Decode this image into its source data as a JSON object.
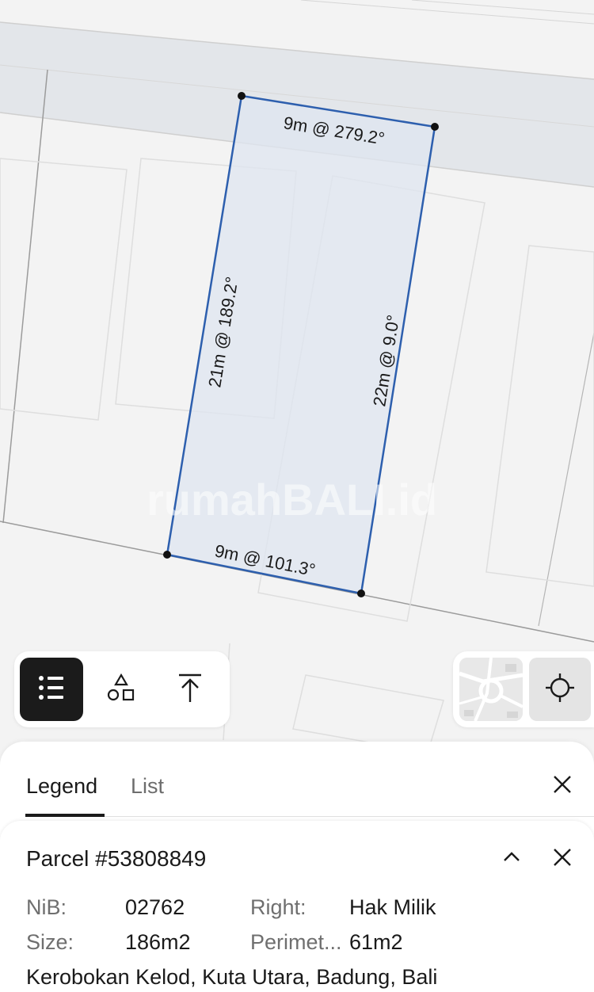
{
  "map": {
    "edges": {
      "top": "9m @ 279.2°",
      "left": "21m @ 189.2°",
      "right": "22m @ 9.0°",
      "bottom": "9m @ 101.3°"
    },
    "watermark": "rumahBALI.id",
    "parcel_stroke_color": "#2d5fae",
    "parcel_fill_color": "#dfe5f0"
  },
  "toolbar": {
    "legend_icon": "list-icon",
    "shapes_icon": "shapes-icon",
    "export_icon": "upload-arrow-icon"
  },
  "map_controls": {
    "basemap_icon": "basemap-thumbnail",
    "locate_icon": "crosshair-icon"
  },
  "panel": {
    "tabs": [
      {
        "label": "Legend",
        "active": true
      },
      {
        "label": "List",
        "active": false
      }
    ]
  },
  "parcel": {
    "title": "Parcel #53808849",
    "nib_label": "NiB:",
    "nib_value": "02762",
    "right_label": "Right:",
    "right_value": "Hak Milik",
    "size_label": "Size:",
    "size_value": "186m2",
    "perimeter_label": "Perimet...",
    "perimeter_value": "61m2",
    "address": "Kerobokan Kelod, Kuta Utara, Badung, Bali"
  }
}
